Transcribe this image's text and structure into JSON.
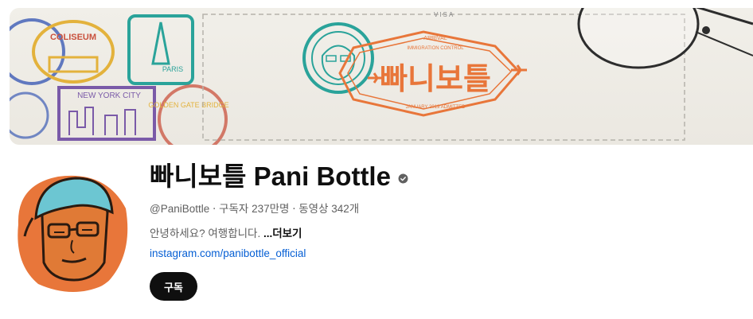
{
  "banner": {
    "visa_label": "VISA",
    "stamp_arrival": "ARRIVAL",
    "stamp_immigration": "IMMIGRATION CONTROL",
    "stamp_name_kr": "빠니보틀",
    "stamp_date": "JANUARY 2019 ADMITTED",
    "stamp_coliseum": "COLISEUM",
    "stamp_paris": "PARIS",
    "stamp_ny": "NEW YORK CITY",
    "stamp_gg": "GOLDEN GATE BRIDGE",
    "round_stamp_text": "Pani BOTTLE",
    "colors": {
      "orange": "#e8763a",
      "teal": "#2aa39a",
      "blue": "#3c5bb5",
      "purple": "#7a5aa8",
      "red": "#c9513d"
    }
  },
  "channel": {
    "title": "빠니보틀 Pani Bottle",
    "verified_icon": "verified-check-icon",
    "handle": "@PaniBottle",
    "separator": "‧",
    "subscribers": "구독자 237만명",
    "videos": "동영상 342개",
    "description": "안녕하세요? 여행합니다. ",
    "more_label": "...더보기",
    "link": "instagram.com/panibottle_official",
    "subscribe_label": "구독"
  }
}
